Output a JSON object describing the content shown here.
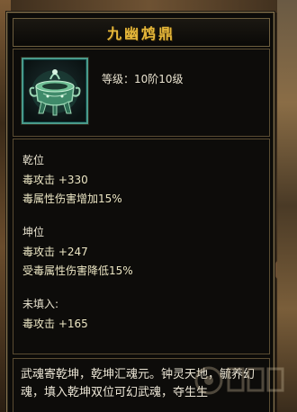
{
  "item": {
    "name": "九幽鸩鼎",
    "level_text": "等级：10阶10级"
  },
  "attributes": {
    "qian": {
      "label": "乾位",
      "lines": [
        "毒攻击  +330",
        "毒属性伤害增加15%"
      ]
    },
    "kun": {
      "label": "坤位",
      "lines": [
        "毒攻击  +247",
        "受毒属性伤害降低15%"
      ]
    },
    "unfilled": {
      "label": "未填入:",
      "lines": [
        "毒攻击  +165"
      ]
    }
  },
  "description": "武魂寄乾坤，乾坤汇魂元。钟灵天地，毓养幻魂，填入乾坤双位可幻武魂，夺生生",
  "colors": {
    "title": "#e7b83a",
    "border": "#8a7650",
    "panel_bg": "#0c0b09",
    "text": "#e8e2cf"
  },
  "icons": {
    "item_icon": "bronze-cauldron-icon"
  }
}
